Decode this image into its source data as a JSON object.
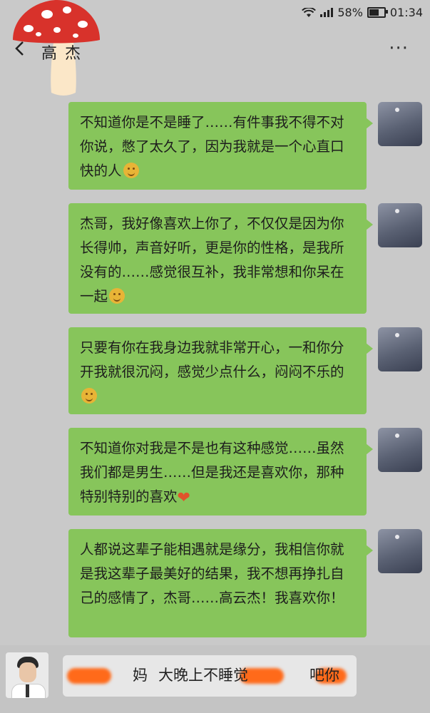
{
  "status": {
    "battery": "58%",
    "time": "01:34",
    "battery_level": 0.58
  },
  "header": {
    "title": "高云杰",
    "title_visible": "高  杰",
    "more_label": "···"
  },
  "messages": [
    {
      "text": "不知道你是不是睡了……有件事我不得不对你说，憋了太久了，因为我就是一个心直口快的人",
      "emoji": "smile-emoji"
    },
    {
      "text": "杰哥，我好像喜欢上你了，不仅仅是因为你长得帅，声音好听，更是你的性格，是我所没有的……感觉很互补，我非常想和你呆在一起",
      "emoji": "shy-emoji"
    },
    {
      "text": "只要有你在我身边我就非常开心，一和你分开我就很沉闷，感觉少点什么，闷闷不乐的",
      "emoji": "sad-emoji"
    },
    {
      "text": "不知道你对我是不是也有这种感觉……虽然我们都是男生……但是我还是喜欢你，那种特别特别的喜欢",
      "emoji": "heart-emoji"
    },
    {
      "text": "人都说这辈子能相遇就是缘分，我相信你就是我这辈子最美好的结果，我不想再挣扎自己的感情了，杰哥……高云杰！我喜欢你！",
      "emoji": ""
    }
  ],
  "input": {
    "text_part1": "妈",
    "text_part2": "大晚上不睡觉",
    "text_part3": "吧你"
  },
  "colors": {
    "bubble": "#87c55b",
    "background": "#c9c9c9",
    "redaction": "#ff6a1a"
  }
}
